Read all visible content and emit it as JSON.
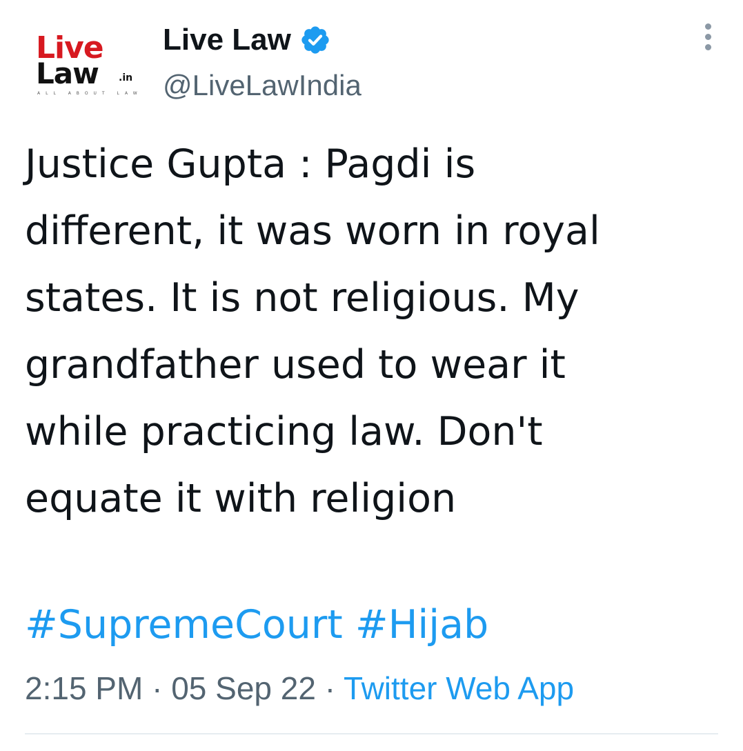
{
  "author": {
    "avatar_logo": {
      "line1": "Live",
      "line2": "Law",
      "suffix": ".in",
      "tagline": "ALL ABOUT LAW"
    },
    "display_name": "Live Law",
    "handle": "@LiveLawIndia",
    "verified_icon": "verified-badge-icon"
  },
  "tweet": {
    "text": "Justice Gupta : Pagdi is\ndifferent, it was worn in royal\nstates. It is not religious. My\ngrandfather used to wear it\nwhile practicing law. Don't\nequate it with religion",
    "hashtags": [
      "#SupremeCourt",
      "#Hijab"
    ],
    "time": "2:15 PM",
    "separator": "·",
    "date": "05 Sep 22",
    "source": "Twitter Web App"
  },
  "colors": {
    "link": "#1d9bf0",
    "secondary_text": "#536471",
    "logo_red": "#d71920"
  },
  "icons": {
    "more": "more-options-icon"
  }
}
